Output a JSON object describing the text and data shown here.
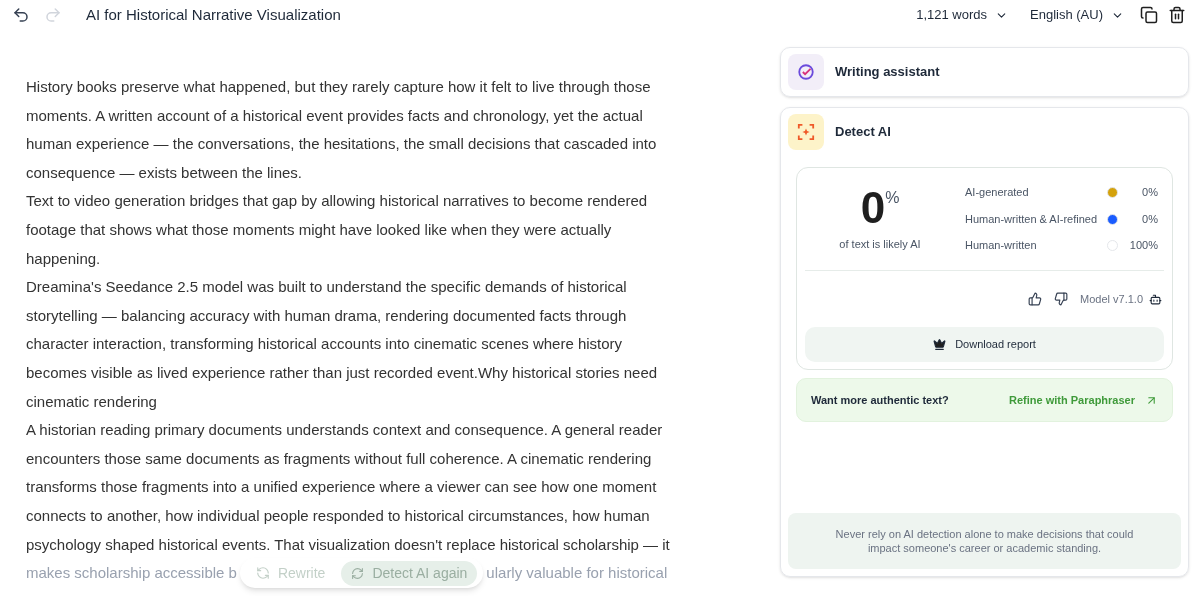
{
  "toolbar": {
    "title": "AI for Historical Narrative Visualization",
    "word_count": "1,121 words",
    "language": "English (AU)"
  },
  "document": {
    "paragraphs": [
      {
        "lines": [
          "History books preserve what happened, but they rarely capture how it felt to live through those",
          "moments. A written account of a historical event provides facts and chronology, yet the actual",
          "human experience — the conversations, the hesitations, the small decisions that cascaded into",
          "consequence — exists between the lines."
        ]
      },
      {
        "lines": [
          "Text to video generation bridges that gap by allowing historical narratives to become rendered",
          "footage that shows what those moments might have looked like when they were actually",
          "happening."
        ]
      },
      {
        "lines": [
          "Dreamina's Seedance 2.5 model was built to understand the specific demands of historical",
          "storytelling — balancing accuracy with human drama, rendering documented facts through",
          "character interaction, transforming historical accounts into cinematic scenes where history",
          "becomes visible as lived experience rather than just recorded event.Why historical stories need",
          "cinematic rendering"
        ]
      },
      {
        "lines": [
          "A historian reading primary documents understands context and consequence. A general reader",
          "encounters those same documents as fragments without full coherence. A cinematic rendering",
          "transforms those fragments into a unified experience where a viewer can see how one moment",
          "connects to another, how individual people responded to historical circumstances, how human",
          "psychology shaped historical events. That visualization doesn't replace historical scholarship — it"
        ]
      }
    ],
    "faded_line": {
      "before": "makes scholarship accessible b",
      "after": "ularly valuable for historical"
    }
  },
  "floating_actions": [
    {
      "label": "Rewrite",
      "disabled": true
    },
    {
      "label": "Detect AI again",
      "disabled": false
    }
  ],
  "panel": {
    "writing_assistant": {
      "title": "Writing assistant"
    },
    "detect_ai": {
      "title": "Detect AI",
      "score": "0",
      "score_unit": "%",
      "score_caption": "of text is likely AI",
      "breakdown": [
        {
          "label": "AI-generated",
          "value": "0%",
          "color": "#d4a20c"
        },
        {
          "label": "Human-written & AI-refined",
          "value": "0%",
          "color": "#1a5cff"
        },
        {
          "label": "Human-written",
          "value": "100%",
          "color": "#ffffff"
        }
      ],
      "model": "Model v7.1.0",
      "download": "Download report"
    },
    "promo": {
      "text": "Want more authentic text?",
      "link": "Refine with Paraphraser"
    },
    "disclaimer": "Never rely on AI detection alone to make decisions that could impact someone's career or academic standing."
  }
}
